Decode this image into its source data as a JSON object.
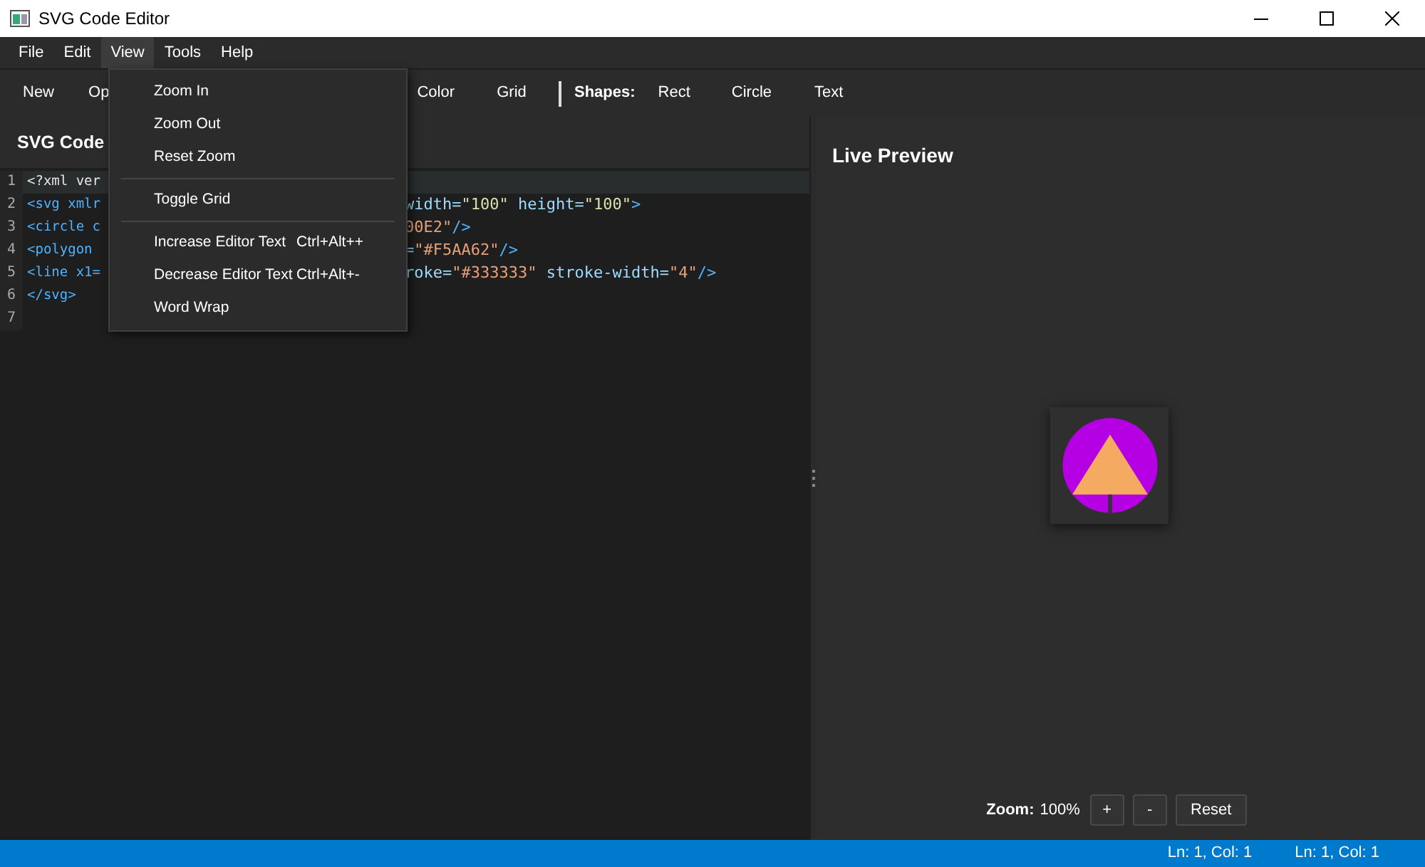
{
  "window": {
    "title": "SVG Code Editor"
  },
  "menu_bar": [
    {
      "label": "File",
      "selected": false
    },
    {
      "label": "Edit",
      "selected": false
    },
    {
      "label": "View",
      "selected": true
    },
    {
      "label": "Tools",
      "selected": false
    },
    {
      "label": "Help",
      "selected": false
    }
  ],
  "view_menu": [
    {
      "kind": "item",
      "label": "Zoom In"
    },
    {
      "kind": "item",
      "label": "Zoom Out"
    },
    {
      "kind": "item",
      "label": "Reset Zoom"
    },
    {
      "kind": "separator"
    },
    {
      "kind": "item",
      "label": "Toggle Grid"
    },
    {
      "kind": "separator"
    },
    {
      "kind": "item",
      "label": "Increase Editor Text",
      "shortcut": "Ctrl+Alt++"
    },
    {
      "kind": "item",
      "label": "Decrease Editor Text",
      "shortcut": "Ctrl+Alt+-"
    },
    {
      "kind": "item",
      "label": "Word Wrap"
    }
  ],
  "toolbar": [
    {
      "kind": "button",
      "label": "New"
    },
    {
      "kind": "button",
      "label": "Op"
    },
    {
      "kind": "button",
      "label": "Color"
    },
    {
      "kind": "button",
      "label": "Grid"
    },
    {
      "kind": "separator"
    },
    {
      "kind": "label",
      "label": "Shapes:"
    },
    {
      "kind": "button",
      "label": "Rect"
    },
    {
      "kind": "button",
      "label": "Circle"
    },
    {
      "kind": "button",
      "label": "Text"
    }
  ],
  "editor": {
    "title": "SVG Code",
    "lines": [
      {
        "number": "1",
        "current": true,
        "left": [
          {
            "kind": "plain",
            "text": "<?xml ver"
          }
        ]
      },
      {
        "number": "2",
        "current": false,
        "left": [
          {
            "kind": "tag",
            "text": "<svg xmlr"
          }
        ],
        "right": [
          {
            "kind": "attr",
            "text": "width="
          },
          {
            "kind": "number",
            "text": "\"100\""
          },
          {
            "kind": "attr",
            "text": " height="
          },
          {
            "kind": "number",
            "text": "\"100\""
          },
          {
            "kind": "tag",
            "text": ">"
          }
        ]
      },
      {
        "number": "3",
        "current": false,
        "left": [
          {
            "kind": "tag",
            "text": "<circle c"
          }
        ],
        "right": [
          {
            "kind": "string",
            "text": "00E2\""
          },
          {
            "kind": "tag",
            "text": "/>"
          }
        ]
      },
      {
        "number": "4",
        "current": false,
        "left": [
          {
            "kind": "tag",
            "text": "<polygon"
          }
        ],
        "right": [
          {
            "kind": "attr",
            "text": "="
          },
          {
            "kind": "string",
            "text": "\"#F5AA62\""
          },
          {
            "kind": "tag",
            "text": "/>"
          }
        ]
      },
      {
        "number": "5",
        "current": false,
        "left": [
          {
            "kind": "tag",
            "text": "<line x1="
          }
        ],
        "right": [
          {
            "kind": "attr",
            "text": "roke="
          },
          {
            "kind": "string",
            "text": "\"#333333\""
          },
          {
            "kind": "attr",
            "text": " stroke-width="
          },
          {
            "kind": "string",
            "text": "\"4\""
          },
          {
            "kind": "tag",
            "text": "/>"
          }
        ]
      },
      {
        "number": "6",
        "current": false,
        "left": [
          {
            "kind": "tag",
            "text": "</svg>"
          }
        ]
      },
      {
        "number": "7",
        "current": false
      }
    ]
  },
  "preview": {
    "title": "Live Preview",
    "zoom_label": "Zoom:",
    "zoom_value": "100%",
    "buttons": [
      "+",
      "-",
      "Reset"
    ]
  },
  "status_bar": [
    "Ln: 1, Col: 1",
    "Ln: 1, Col: 1"
  ]
}
